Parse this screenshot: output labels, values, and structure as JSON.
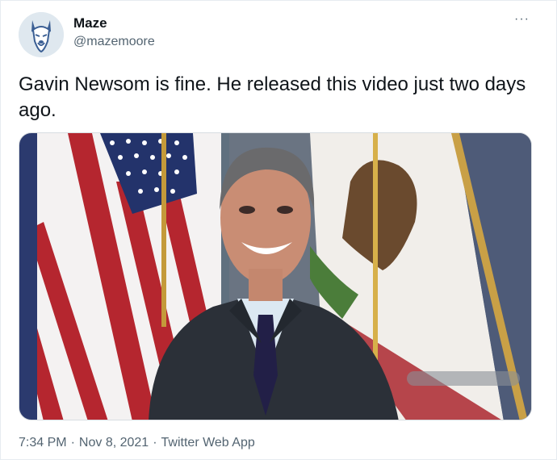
{
  "author": {
    "display_name": "Maze",
    "handle": "@mazemoore",
    "avatar_icon": "dog-logo-icon"
  },
  "more_label": "···",
  "tweet": {
    "text": "Gavin Newsom is fine. He released this video just two days ago."
  },
  "media": {
    "description_icon": "video-thumbnail"
  },
  "meta": {
    "time": "7:34 PM",
    "separator": "·",
    "date": "Nov 8, 2021",
    "source": "Twitter Web App"
  },
  "colors": {
    "text": "#0f1419",
    "muted": "#536471",
    "border": "#e6ecf0"
  }
}
